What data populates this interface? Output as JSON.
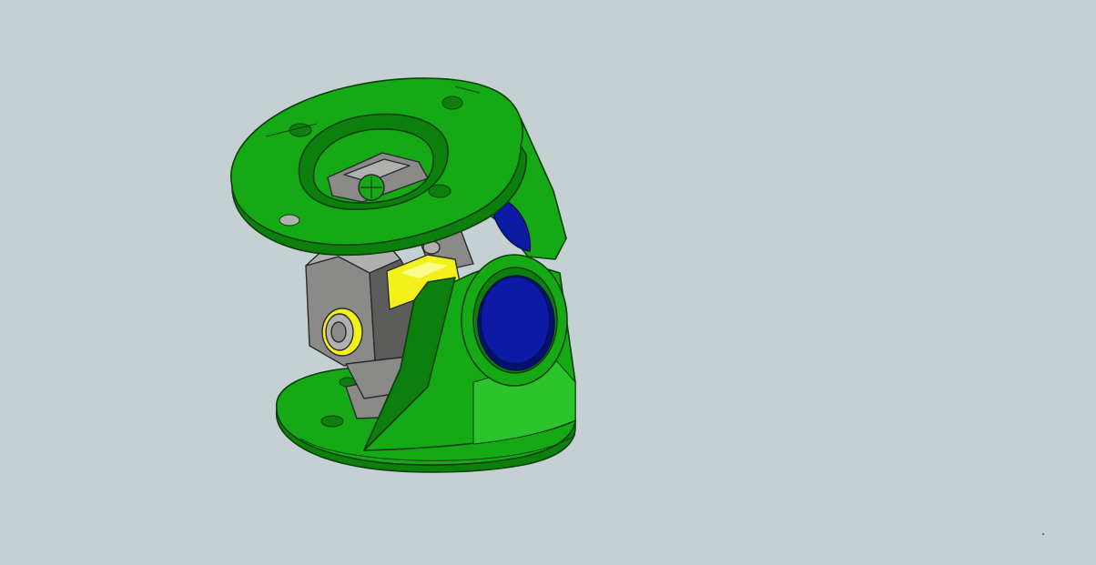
{
  "viewport": {
    "background": "#c5d0d2"
  },
  "model": {
    "parts": [
      {
        "name": "top-flange",
        "color": "#16a916"
      },
      {
        "name": "bearing-support",
        "color": "#16a916"
      },
      {
        "name": "base-flange",
        "color": "#16a916"
      },
      {
        "name": "cross-spider",
        "color": "#8a8a88"
      },
      {
        "name": "center-pin",
        "color": "#f2f21a"
      },
      {
        "name": "bearing-cap",
        "color": "#0c1aa6"
      }
    ],
    "colors": {
      "green": "#16a916",
      "green_dark": "#0d7f0d",
      "green_light": "#2cc42c",
      "gray": "#8a8a88",
      "gray_dark": "#5c5c5a",
      "gray_light": "#b0b0ae",
      "yellow": "#f2f21a",
      "blue": "#0c1aa6",
      "blue_dark": "#061070",
      "outline": "#0b3f0b"
    }
  }
}
